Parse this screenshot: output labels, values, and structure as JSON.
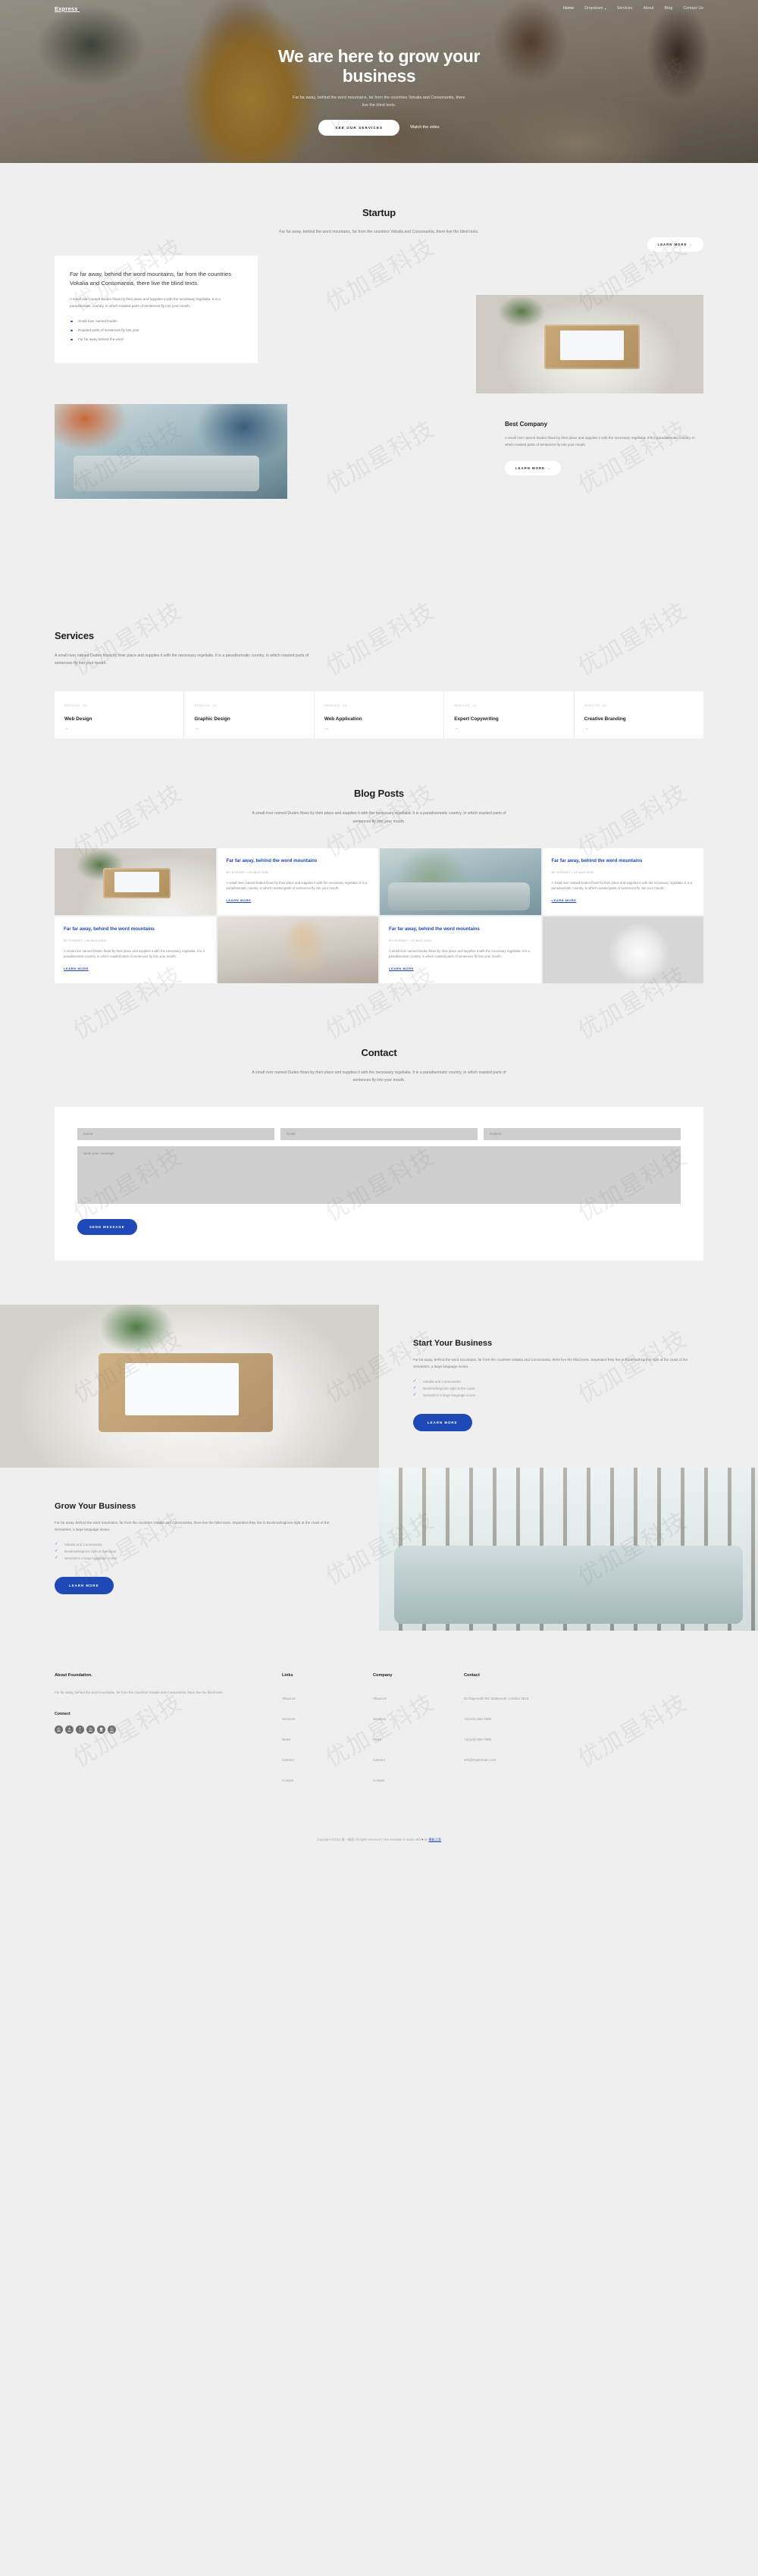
{
  "brand": {
    "name": "Express",
    "accent": "#1f49b6"
  },
  "nav": {
    "items": [
      {
        "label": "Home",
        "active": true
      },
      {
        "label": "Dropdown",
        "caret": "⌄"
      },
      {
        "label": "Services"
      },
      {
        "label": "About"
      },
      {
        "label": "Blog"
      },
      {
        "label": "Contact Us"
      }
    ]
  },
  "hero": {
    "title": "We are here to grow your business",
    "subtitle": "Far far away, behind the word mountains, far from the countries Vokalia and Consonantia, there live the blind texts.",
    "primary_btn": "SEE OUR SERVICES",
    "video_link": "Watch the video"
  },
  "startup": {
    "heading": "Startup",
    "lead": "Far far away, behind the word mountains, far from the countries Vokalia and Consonantia, there live the blind texts.",
    "learn_more": "LEARN MORE",
    "arrow": "→",
    "card": {
      "title": "Far far away, behind the word mountains, far from the countries Vokalia and Consonantia, there live the blind texts.",
      "body": "A small river named Duden flows by their place and supplies it with the necessary regelialia. It is a paradisematic country, in which roasted parts of sentences fly into your mouth.",
      "bullets": [
        "Small river named Duden",
        "Roasted parts of sentences fly into your",
        "Far far away behind the word"
      ]
    },
    "best_company": {
      "heading": "Best Company",
      "body": "A small river named Duden flows by their place and supplies it with the necessary regelialia. It is a paradisematic country, in which roasted parts of sentences fly into your mouth.",
      "learn_more": "LEARN MORE"
    }
  },
  "services": {
    "heading": "Services",
    "lead": "A small river named Duden flows by their place and supplies it with the necessary regelialia. It is a paradisematic country, in which roasted parts of sentences fly into your mouth.",
    "arrow": "→",
    "items": [
      {
        "num": "SERVICE .01",
        "name": "Web Design"
      },
      {
        "num": "SERVICE .02",
        "name": "Graphic Design"
      },
      {
        "num": "SERVICE .03",
        "name": "Web Application"
      },
      {
        "num": "SERVICE .04",
        "name": "Expert Copywriting"
      },
      {
        "num": "SERVICE .05",
        "name": "Creative Branding"
      }
    ]
  },
  "blog": {
    "heading": "Blog Posts",
    "lead": "A small river named Duden flows by their place and supplies it with the necessary regelialia. It is a paradisematic country, in which roasted parts of sentences fly into your mouth.",
    "learn_more": "LEARN MORE",
    "posts": [
      {
        "title": "Far far away, behind the word mountains",
        "meta": "BY SYRGEY • 23 AUG 2020",
        "body": "A small river named Duden flows by their place and supplies it with the necessary regelialia. It is a paradisematic country, in which roasted parts of sentences fly into your mouth."
      },
      {
        "title": "Far far away, behind the word mountains",
        "meta": "BY SYRGEY • 23 AUG 2020",
        "body": "A small river named Duden flows by their place and supplies it with the necessary regelialia. It is a paradisematic country, in which roasted parts of sentences fly into your mouth."
      },
      {
        "title": "Far far away, behind the word mountains",
        "meta": "BY SYRGEY • 23 AUG 2020",
        "body": "A small river named Duden flows by their place and supplies it with the necessary regelialia. It is a paradisematic country, in which roasted parts of sentences fly into your mouth."
      },
      {
        "title": "Far far away, behind the word mountains",
        "meta": "BY SYRGEY • 23 AUG 2020",
        "body": "A small river named Duden flows by their place and supplies it with the necessary regelialia. It is a paradisematic country, in which roasted parts of sentences fly into your mouth."
      }
    ]
  },
  "contact": {
    "heading": "Contact",
    "lead": "A small river named Duden flows by their place and supplies it with the necessary regelialia. It is a paradisematic country, in which roasted parts of sentences fly into your mouth.",
    "name_placeholder": "Name",
    "email_placeholder": "Email",
    "subject_placeholder": "Subject",
    "message_placeholder": "Write your message",
    "submit": "SEND MESSAGE"
  },
  "start_business": {
    "heading": "Start Your Business",
    "body": "Far far away, behind the word mountains, far from the countries Vokalia and Consonantia, there live the blind texts. Separated they live in Bookmarksgrove right at the coast of the Semantics, a large language ocean.",
    "checks": [
      "Vokalia and Consonantia",
      "Bookmarksgrove right at the coast",
      "Semantics a large language ocean"
    ],
    "button": "LEARN MORE"
  },
  "grow_business": {
    "heading": "Grow Your Business",
    "body": "Far far away, behind the word mountains, far from the countries Vokalia and Consonantia, there live the blind texts. Separated they live in Bookmarksgrove right at the coast of the Semantics, a large language ocean.",
    "checks": [
      "Vokalia and Consonantia",
      "Bookmarksgrove right at the coast",
      "Semantics a large language ocean"
    ],
    "button": "LEARN MORE"
  },
  "footer": {
    "about": {
      "heading": "About Foundation",
      "heading_dot": ".",
      "body": "Far far away, behind the word mountains, far from the countries Vokalia and Consonantia, there live the blind texts.",
      "connect_heading": "Connect",
      "socials": [
        {
          "name": "instagram-icon",
          "glyph": "◎"
        },
        {
          "name": "twitter-icon",
          "glyph": "✦"
        },
        {
          "name": "facebook-icon",
          "glyph": "f"
        },
        {
          "name": "linkedin-icon",
          "glyph": "in"
        },
        {
          "name": "dribbble-icon",
          "glyph": "●"
        },
        {
          "name": "behance-icon",
          "glyph": "Ⓑ"
        }
      ]
    },
    "links": {
      "heading": "Links",
      "items": [
        "About us",
        "Services",
        "News",
        "Careers",
        "Contact"
      ]
    },
    "company": {
      "heading": "Company",
      "items": [
        "About us",
        "Services",
        "News",
        "Careers",
        "Contact"
      ]
    },
    "contact": {
      "heading": "Contact",
      "items": [
        "43 Raymouth Rd. Baltemoer, London 3910",
        "+1(123)-456-7890",
        "+1(123)-456-7890",
        "info@mydomain.com"
      ]
    },
    "copyright_prefix": "Copyright ©2021 第一模版 All rights reserved | This template is made with ",
    "copyright_heart": "♥",
    "copyright_mid": " by ",
    "copyright_link": "模板之家"
  },
  "watermark": {
    "text": "优加星科技"
  }
}
